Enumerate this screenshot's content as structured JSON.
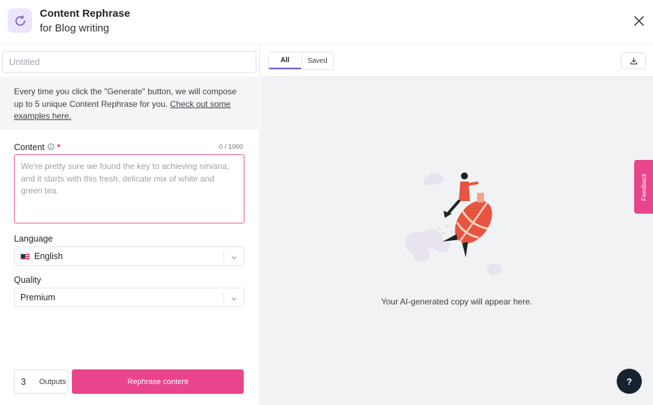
{
  "header": {
    "title": "Content Rephrase",
    "subtitle": "for Blog writing",
    "icon": "refresh-icon",
    "icon_bg": "#ece5fb",
    "icon_color": "#6b5bd6"
  },
  "left": {
    "title_input": {
      "placeholder": "Untitled",
      "value": ""
    },
    "info": {
      "text": "Every time you click the \"Generate\" button, we will compose up to 5 unique Content Rephrase for you. ",
      "link": "Check out some examples here."
    },
    "content": {
      "label": "Content",
      "required_mark": "*",
      "counter": "0 / 1000",
      "placeholder": "We're pretty sure we found the key to achieving nirvana, and it starts with this fresh, delicate mix of white and green tea."
    },
    "language": {
      "label": "Language",
      "value": "English",
      "flag": "us-flag-icon"
    },
    "quality": {
      "label": "Quality",
      "value": "Premium"
    },
    "outputs": {
      "value": "3",
      "label": "Outputs"
    },
    "generate_button": "Rephrase content"
  },
  "right": {
    "tabs": [
      {
        "label": "All",
        "active": true
      },
      {
        "label": "Saved",
        "active": false
      }
    ],
    "empty_message": "Your AI-generated copy will appear here."
  },
  "feedback_label": "Feedback",
  "help_label": "?",
  "colors": {
    "accent_pink": "#e8458c",
    "tab_indicator": "#6b5bd6",
    "panel_bg": "#f1f2f4",
    "help_bg": "#17222e"
  }
}
